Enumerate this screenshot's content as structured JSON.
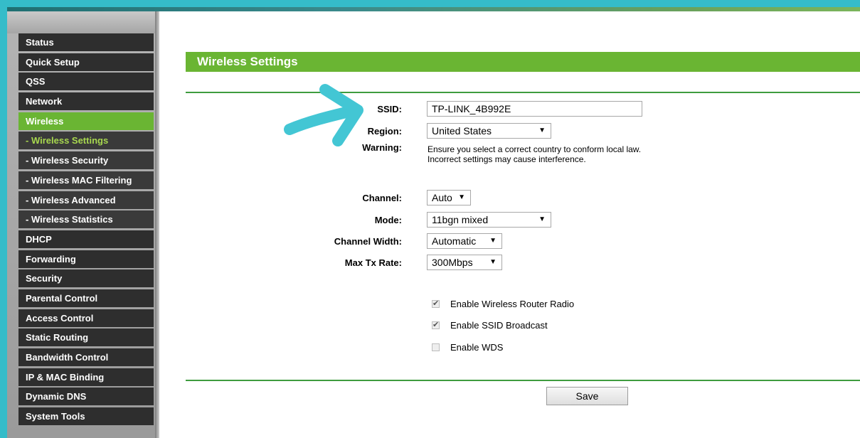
{
  "sidebar": {
    "items": [
      {
        "label": "Status"
      },
      {
        "label": "Quick Setup"
      },
      {
        "label": "QSS"
      },
      {
        "label": "Network"
      },
      {
        "label": "Wireless"
      },
      {
        "label": "- Wireless Settings"
      },
      {
        "label": "- Wireless Security"
      },
      {
        "label": "- Wireless MAC Filtering"
      },
      {
        "label": "- Wireless Advanced"
      },
      {
        "label": "- Wireless Statistics"
      },
      {
        "label": "DHCP"
      },
      {
        "label": "Forwarding"
      },
      {
        "label": "Security"
      },
      {
        "label": "Parental Control"
      },
      {
        "label": "Access Control"
      },
      {
        "label": "Static Routing"
      },
      {
        "label": "Bandwidth Control"
      },
      {
        "label": "IP & MAC Binding"
      },
      {
        "label": "Dynamic DNS"
      },
      {
        "label": "System Tools"
      }
    ],
    "active_color": "#6ab533",
    "current_sub_color": "#a8d84f"
  },
  "main": {
    "title": "Wireless Settings",
    "ssid": {
      "label": "SSID:",
      "value": "TP-LINK_4B992E"
    },
    "region": {
      "label": "Region:",
      "value": "United States"
    },
    "warning": {
      "label": "Warning:",
      "line1": "Ensure you select a correct country to conform local law.",
      "line2": "Incorrect settings may cause interference."
    },
    "channel": {
      "label": "Channel:",
      "value": "Auto"
    },
    "mode": {
      "label": "Mode:",
      "value": "11bgn mixed"
    },
    "channel_width": {
      "label": "Channel Width:",
      "value": "Automatic"
    },
    "max_tx_rate": {
      "label": "Max Tx Rate:",
      "value": "300Mbps"
    },
    "checkboxes": [
      {
        "label": "Enable Wireless Router Radio",
        "checked": true
      },
      {
        "label": "Enable SSID Broadcast",
        "checked": true
      },
      {
        "label": "Enable WDS",
        "checked": false
      }
    ],
    "save_label": "Save"
  },
  "theme": {
    "accent": "#6ab533",
    "frame": "#35bcc9",
    "arrow": "#43c6d4"
  },
  "annotation": {
    "arrow_icon": "arrow-right-icon"
  }
}
